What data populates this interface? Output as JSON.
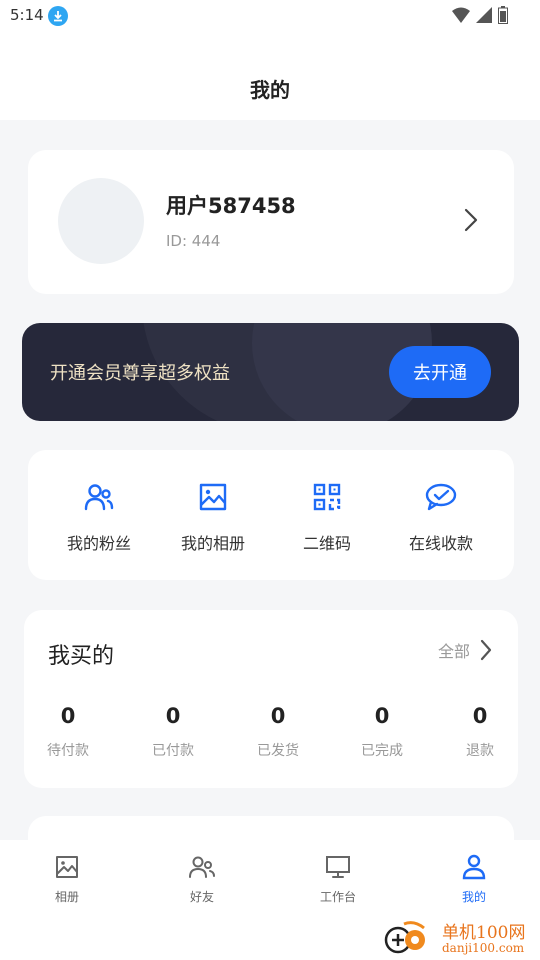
{
  "status_bar": {
    "time": "5:14"
  },
  "header": {
    "title": "我的"
  },
  "profile": {
    "username": "用户587458",
    "id_label": "ID: 444"
  },
  "vip": {
    "text": "开通会员尊享超多权益",
    "button_label": "去开通"
  },
  "tools": [
    {
      "label": "我的粉丝",
      "icon": "fans-icon"
    },
    {
      "label": "我的相册",
      "icon": "album-icon"
    },
    {
      "label": "二维码",
      "icon": "qrcode-icon"
    },
    {
      "label": "在线收款",
      "icon": "payment-icon"
    }
  ],
  "orders": {
    "title": "我买的",
    "all_label": "全部",
    "items": [
      {
        "count": "0",
        "label": "待付款"
      },
      {
        "count": "0",
        "label": "已付款"
      },
      {
        "count": "0",
        "label": "已发货"
      },
      {
        "count": "0",
        "label": "已完成"
      },
      {
        "count": "0",
        "label": "退款"
      }
    ]
  },
  "tabbar": [
    {
      "label": "相册",
      "icon": "album-icon",
      "active": false
    },
    {
      "label": "好友",
      "icon": "friends-icon",
      "active": false
    },
    {
      "label": "工作台",
      "icon": "monitor-icon",
      "active": false
    },
    {
      "label": "我的",
      "icon": "user-icon",
      "active": true
    }
  ],
  "watermark": {
    "line1": "单机100网",
    "line2": "danji100.com"
  },
  "colors": {
    "accent": "#1e6bf6",
    "vip_bg": "#26283a",
    "vip_text": "#efe2c4",
    "page_bg": "#f5f6f8"
  }
}
